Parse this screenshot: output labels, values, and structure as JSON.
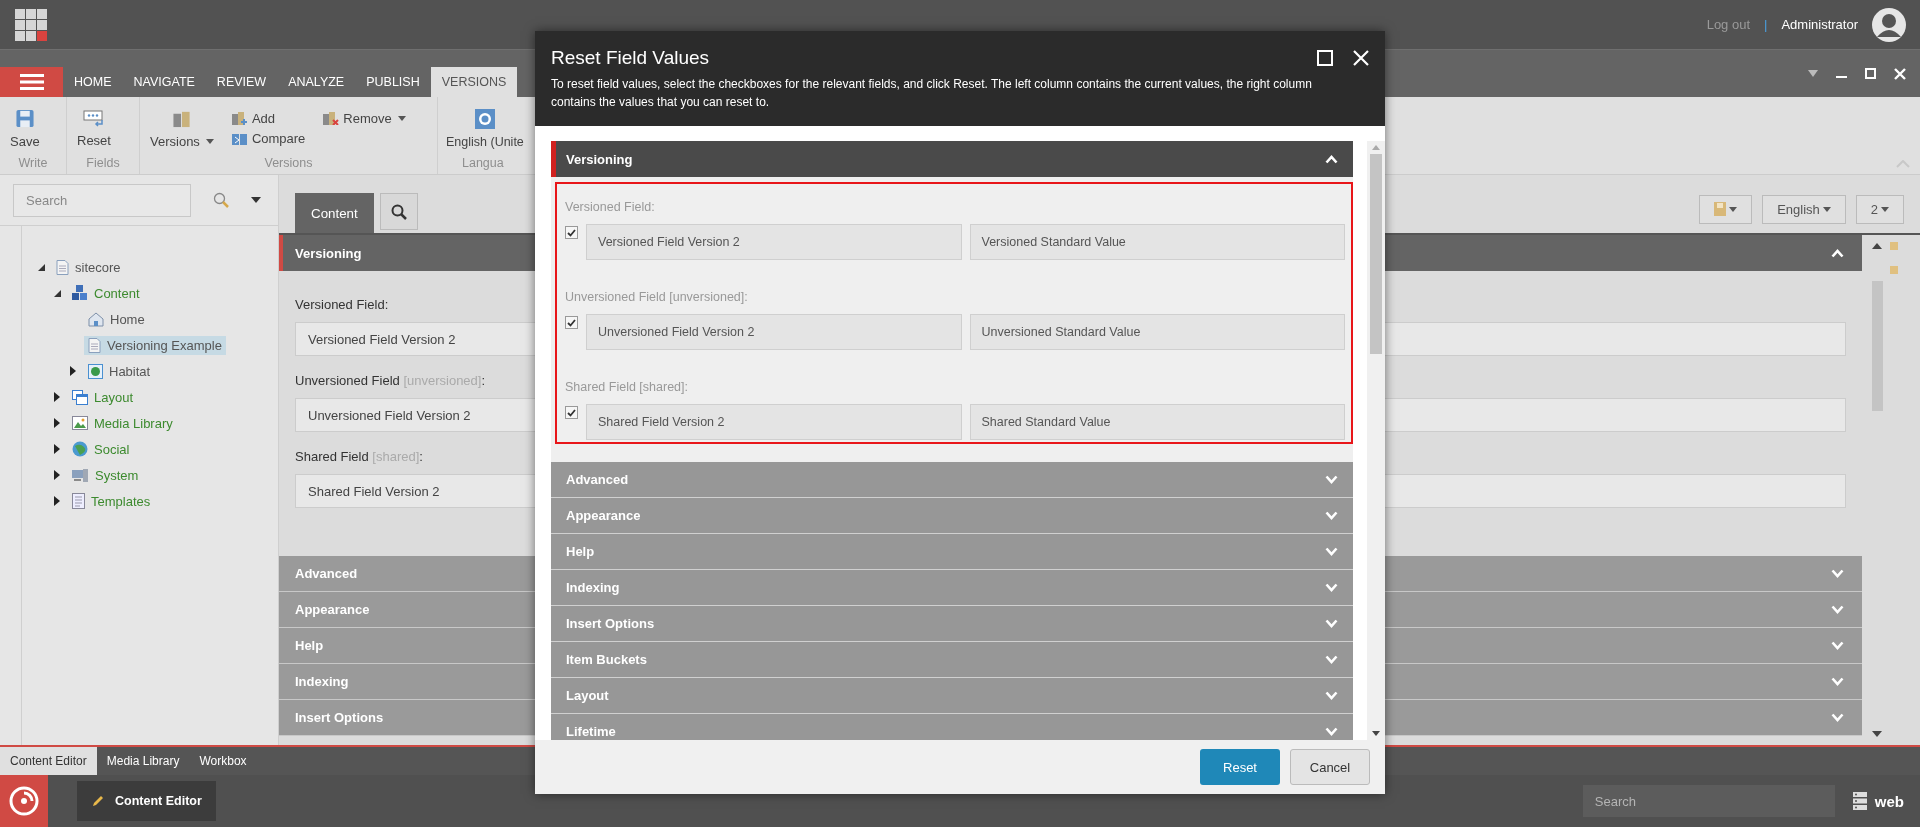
{
  "top_bar": {
    "logout": "Log out",
    "separator": "|",
    "user": "Administrator"
  },
  "ribbon_tabs": [
    {
      "label": "HOME",
      "selected": false
    },
    {
      "label": "NAVIGATE",
      "selected": false
    },
    {
      "label": "REVIEW",
      "selected": false
    },
    {
      "label": "ANALYZE",
      "selected": false
    },
    {
      "label": "PUBLISH",
      "selected": false
    },
    {
      "label": "VERSIONS",
      "selected": true
    }
  ],
  "ribbon_groups": [
    {
      "label": "Write",
      "items": [
        {
          "label": "Save",
          "kind": "save",
          "dropdown": false
        }
      ]
    },
    {
      "label": "Fields",
      "items": [
        {
          "label": "Reset",
          "kind": "reset",
          "dropdown": false
        }
      ]
    },
    {
      "label": "Versions",
      "items": [
        {
          "label": "Versions",
          "kind": "versions",
          "dropdown": true
        },
        {
          "label": "Add",
          "kind": "add",
          "dropdown": false
        },
        {
          "label": "Compare",
          "kind": "compare",
          "dropdown": false
        },
        {
          "label": "Remove",
          "kind": "remove",
          "dropdown": true
        }
      ]
    },
    {
      "label": "Langua",
      "items": [
        {
          "label": "English (Unite",
          "kind": "language",
          "dropdown": false
        }
      ]
    }
  ],
  "search": {
    "placeholder": "Search"
  },
  "tree": [
    {
      "label": "sitecore",
      "kind": "document",
      "expandable": true,
      "expanded": true,
      "selected": false,
      "color": "#555555",
      "children": [
        {
          "label": "Content",
          "kind": "content",
          "expandable": true,
          "expanded": true,
          "selected": false,
          "color": "#3c8a2e",
          "children": [
            {
              "label": "Home",
              "kind": "home",
              "expandable": false,
              "selected": false,
              "color": "#555555"
            },
            {
              "label": "Versioning Example",
              "kind": "document",
              "expandable": false,
              "selected": true,
              "color": "#555555"
            },
            {
              "label": "Habitat",
              "kind": "site",
              "expandable": true,
              "expanded": false,
              "selected": false,
              "color": "#555555"
            }
          ]
        },
        {
          "label": "Layout",
          "kind": "layout",
          "expandable": true,
          "expanded": false,
          "selected": false,
          "color": "#3c8a2e"
        },
        {
          "label": "Media Library",
          "kind": "media",
          "expandable": true,
          "expanded": false,
          "selected": false,
          "color": "#3c8a2e"
        },
        {
          "label": "Social",
          "kind": "social",
          "expandable": true,
          "expanded": false,
          "selected": false,
          "color": "#3c8a2e"
        },
        {
          "label": "System",
          "kind": "system",
          "expandable": true,
          "expanded": false,
          "selected": false,
          "color": "#3c8a2e"
        },
        {
          "label": "Templates",
          "kind": "templates",
          "expandable": true,
          "expanded": false,
          "selected": false,
          "color": "#3c8a2e"
        }
      ]
    }
  ],
  "content": {
    "tabs": [
      {
        "label": "Content",
        "selected": true
      }
    ],
    "language": "English",
    "version": "2",
    "sections": [
      {
        "title": "Versioning",
        "expanded": true,
        "fields": [
          {
            "label": "Versioned Field",
            "suffix": ":",
            "value": "Versioned Field Version 2"
          },
          {
            "label": "Unversioned Field",
            "qualifier": "[unversioned]",
            "suffix": ":",
            "value": "Unversioned Field Version 2"
          },
          {
            "label": "Shared Field",
            "qualifier": "[shared]",
            "suffix": ":",
            "value": "Shared Field Version 2"
          }
        ]
      },
      {
        "title": "Advanced",
        "expanded": false
      },
      {
        "title": "Appearance",
        "expanded": false
      },
      {
        "title": "Help",
        "expanded": false
      },
      {
        "title": "Indexing",
        "expanded": false
      },
      {
        "title": "Insert Options",
        "expanded": false
      }
    ]
  },
  "dialog": {
    "title": "Reset Field Values",
    "description": "To reset field values, select the checkboxes for the relevant fields, and click Reset. The left column contains the current values, the right column contains the values that you can reset to.",
    "sections": [
      {
        "title": "Versioning",
        "expanded": true,
        "fields": [
          {
            "label": "Versioned Field:",
            "checked": true,
            "current": "Versioned Field Version 2",
            "standard": "Versioned Standard Value"
          },
          {
            "label": "Unversioned Field [unversioned]:",
            "checked": true,
            "current": "Unversioned Field Version 2",
            "standard": "Unversioned Standard Value"
          },
          {
            "label": "Shared Field [shared]:",
            "checked": true,
            "current": "Shared Field Version 2",
            "standard": "Shared Standard Value"
          }
        ]
      },
      {
        "title": "Advanced",
        "expanded": false
      },
      {
        "title": "Appearance",
        "expanded": false
      },
      {
        "title": "Help",
        "expanded": false
      },
      {
        "title": "Indexing",
        "expanded": false
      },
      {
        "title": "Insert Options",
        "expanded": false
      },
      {
        "title": "Item Buckets",
        "expanded": false
      },
      {
        "title": "Layout",
        "expanded": false
      },
      {
        "title": "Lifetime",
        "expanded": false
      }
    ],
    "buttons": [
      {
        "label": "Reset",
        "kind": "primary"
      },
      {
        "label": "Cancel",
        "kind": "secondary"
      }
    ]
  },
  "bottom_tabs": [
    {
      "label": "Content Editor",
      "selected": true
    },
    {
      "label": "Media Library",
      "selected": false
    },
    {
      "label": "Workbox",
      "selected": false
    }
  ],
  "taskbar": {
    "app": "Content Editor",
    "search_placeholder": "Search",
    "database": "web"
  }
}
